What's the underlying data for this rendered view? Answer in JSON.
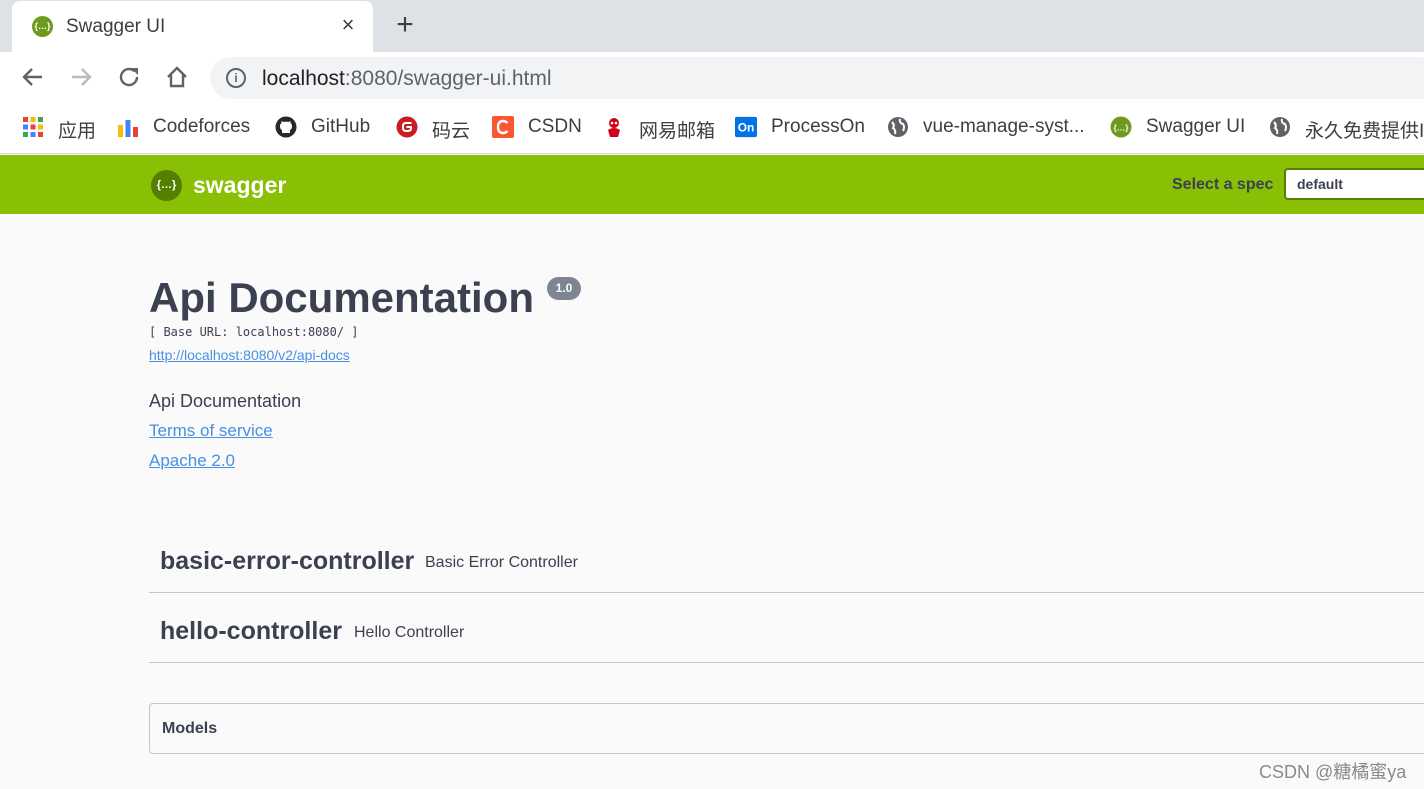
{
  "browser": {
    "tab": {
      "title": "Swagger UI",
      "favicon": "{…}",
      "close": "×"
    },
    "new_tab": "+",
    "url": {
      "host": "localhost",
      "rest": ":8080/swagger-ui.html"
    },
    "info_icon": "i"
  },
  "bookmarks": [
    {
      "label": "应用",
      "icon": "apps-grid-icon"
    },
    {
      "label": "Codeforces",
      "icon": "codeforces-icon"
    },
    {
      "label": "GitHub",
      "icon": "github-icon"
    },
    {
      "label": "码云",
      "icon": "gitee-icon"
    },
    {
      "label": "CSDN",
      "icon": "csdn-icon"
    },
    {
      "label": "网易邮箱",
      "icon": "netease-mail-icon"
    },
    {
      "label": "ProcessOn",
      "icon": "processon-icon"
    },
    {
      "label": "vue-manage-syst...",
      "icon": "globe-icon"
    },
    {
      "label": "Swagger UI",
      "icon": "swagger-icon"
    },
    {
      "label": "永久免费提供Ir",
      "icon": "globe-icon"
    }
  ],
  "swagger": {
    "logo_text": "swagger",
    "logo_icon": "{…}",
    "select_label": "Select a spec",
    "select_value": "default"
  },
  "info": {
    "title": "Api Documentation",
    "version": "1.0",
    "base_url": "[ Base URL: localhost:8080/ ]",
    "spec_link": "http://localhost:8080/v2/api-docs",
    "description": "Api Documentation",
    "terms": "Terms of service",
    "license": "Apache 2.0"
  },
  "controllers": [
    {
      "name": "basic-error-controller",
      "description": "Basic Error Controller"
    },
    {
      "name": "hello-controller",
      "description": "Hello Controller"
    }
  ],
  "models_label": "Models",
  "watermark": "CSDN @糖橘蜜ya"
}
